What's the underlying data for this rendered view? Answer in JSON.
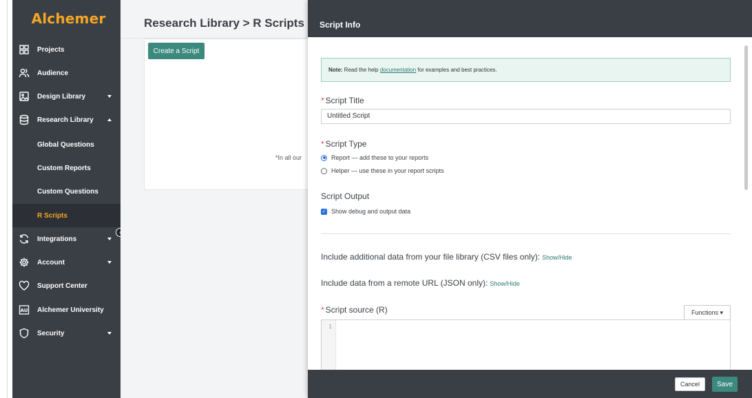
{
  "sidebar": {
    "logo": "Alchemer",
    "items": [
      {
        "label": "Projects",
        "icon": "grid-icon"
      },
      {
        "label": "Audience",
        "icon": "users-icon"
      },
      {
        "label": "Design Library",
        "icon": "image-icon"
      },
      {
        "label": "Research Library",
        "icon": "database-icon"
      },
      {
        "label": "Global Questions"
      },
      {
        "label": "Custom Reports"
      },
      {
        "label": "Custom Questions"
      },
      {
        "label": "R Scripts"
      },
      {
        "label": "Integrations",
        "icon": "sync-icon"
      },
      {
        "label": "Account",
        "icon": "gear-icon"
      },
      {
        "label": "Support Center",
        "icon": "heart-icon"
      },
      {
        "label": "Alchemer University",
        "icon": "university-icon"
      },
      {
        "label": "Security",
        "icon": "shield-icon"
      }
    ]
  },
  "main": {
    "breadcrumb": "Research Library > R Scripts",
    "create_button": "Create a Script",
    "card_note": "*In all our"
  },
  "panel": {
    "title": "Script Info",
    "note_bold": "Note:",
    "note_text_before": " Read the help ",
    "note_link": "documentation",
    "note_text_after": " for examples and best practices.",
    "required_marker": "*",
    "script_title_label": "Script Title",
    "script_title_value": "Untitled Script",
    "script_type_label": "Script Type",
    "script_type_options": [
      {
        "label": "Report — add these to your reports",
        "selected": true
      },
      {
        "label": "Helper — use these in your report scripts",
        "selected": false
      }
    ],
    "script_output_label": "Script Output",
    "debug_checkbox_label": "Show debug and output data",
    "debug_checked": true,
    "file_library_text": "Include additional data from your file library (CSV files only):",
    "file_library_link": "Show/Hide",
    "remote_url_text": "Include data from a remote URL (JSON only):",
    "remote_url_link": "Show/Hide",
    "script_source_label": "Script source (R)",
    "functions_button": "Functions ▾",
    "line_number": "1",
    "cancel_button": "Cancel",
    "save_button": "Save"
  },
  "colors": {
    "sidebar_bg": "#3a3f46",
    "brand_orange": "#f5a623",
    "accent_green": "#3c8a7e",
    "note_bg": "#e8f5f1"
  }
}
